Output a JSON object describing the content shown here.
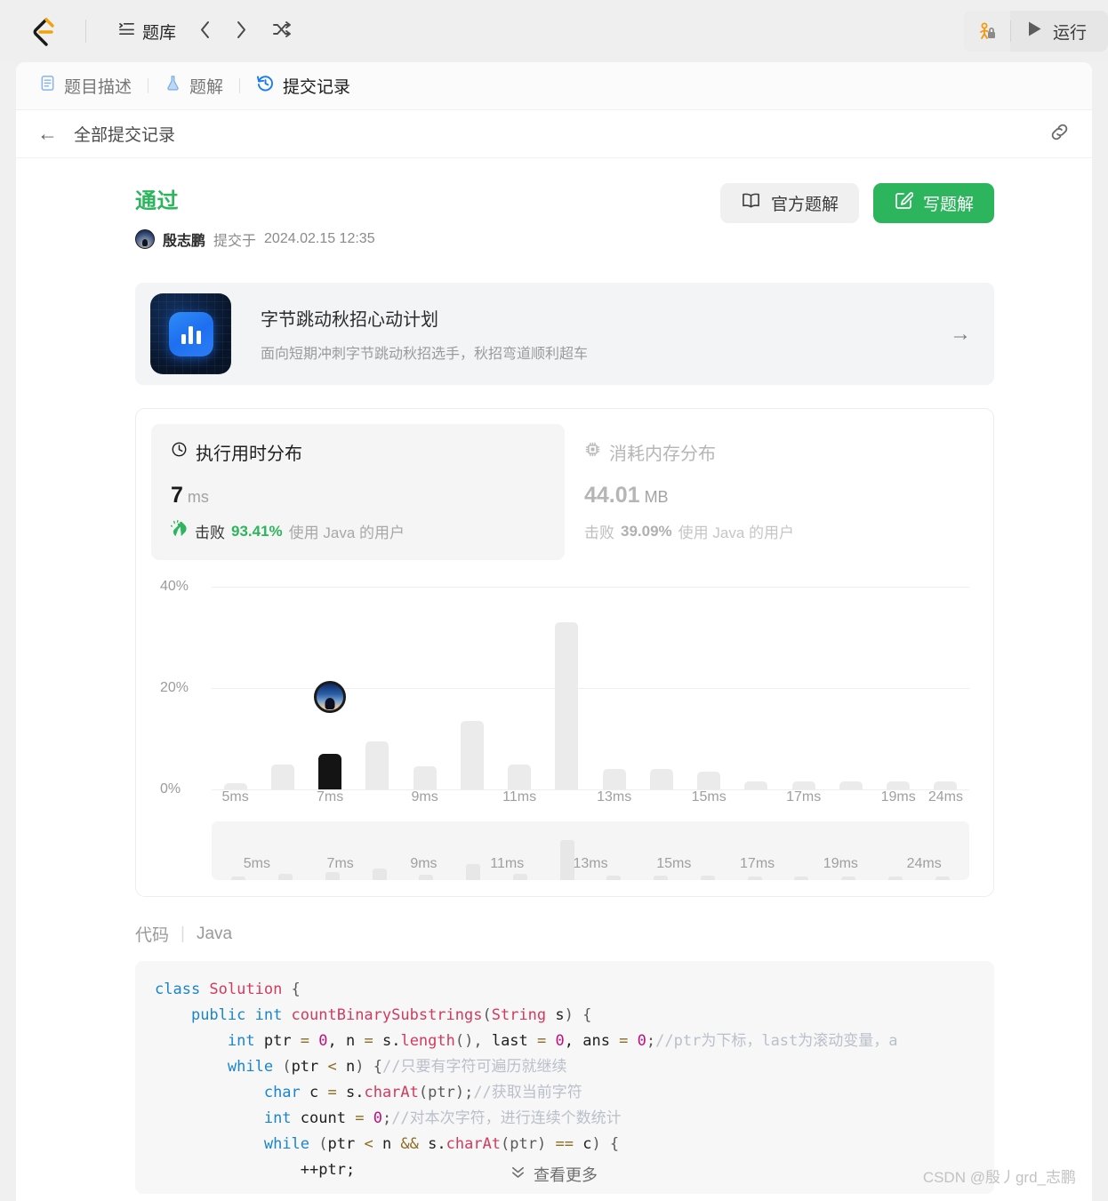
{
  "topbar": {
    "logo_alt": "leetcode-logo",
    "nav": {
      "problems_label": "题库"
    },
    "prev_label": "‹",
    "next_label": "›",
    "shuffle_label": "⤫",
    "run_label": "运行",
    "debug_icon": "debug-lock-icon"
  },
  "tabs": [
    {
      "label": "题目描述",
      "icon": "description-icon",
      "active": false
    },
    {
      "label": "题解",
      "icon": "flask-icon",
      "active": false
    },
    {
      "label": "提交记录",
      "icon": "history-icon",
      "active": true
    }
  ],
  "breadcrumb": {
    "back_label": "←",
    "text": "全部提交记录",
    "link_icon": "link-icon"
  },
  "submission": {
    "verdict": "通过",
    "user": "殷志鹏",
    "submitted_prefix": "提交于",
    "submitted_at": "2024.02.15 12:35",
    "verdict_color": "#2db55d"
  },
  "actions": {
    "official_label": "官方题解",
    "official_icon": "book-icon",
    "write_label": "写题解",
    "write_icon": "pencil-icon",
    "write_color": "#2db55d"
  },
  "promo": {
    "title": "字节跳动秋招心动计划",
    "subtitle": "面向短期冲刺字节跳动秋招选手，秋招弯道顺利超车",
    "arrow": "→",
    "icon": "bar-chart-app-icon"
  },
  "stats": {
    "runtime": {
      "title": "执行用时分布",
      "icon": "clock-icon",
      "value": "7",
      "unit": "ms",
      "beat_label": "击败",
      "beat_pct": "93.41%",
      "beat_tail": "使用 Java 的用户",
      "beat_icon": "clap-icon",
      "active": true
    },
    "memory": {
      "title": "消耗内存分布",
      "icon": "chip-icon",
      "value": "44.01",
      "unit": "MB",
      "beat_label": "击败",
      "beat_pct": "39.09%",
      "beat_tail": "使用 Java 的用户",
      "active": false
    }
  },
  "chart_data": {
    "type": "bar",
    "title": "执行用时分布",
    "xlabel": "",
    "ylabel": "",
    "ylim": [
      0,
      40
    ],
    "yticks": [
      "0%",
      "20%",
      "40%"
    ],
    "grid": true,
    "legend": null,
    "highlight_category": "7ms",
    "highlight_color": "#141414",
    "bar_color": "#ebebeb",
    "categories": [
      "5ms",
      "6ms",
      "7ms",
      "8ms",
      "9ms",
      "10ms",
      "11ms",
      "12ms",
      "13ms",
      "14ms",
      "15ms",
      "16ms",
      "17ms",
      "18ms",
      "19ms",
      "24ms"
    ],
    "tick_labels": [
      "5ms",
      "",
      "7ms",
      "",
      "9ms",
      "",
      "11ms",
      "",
      "13ms",
      "",
      "15ms",
      "",
      "17ms",
      "",
      "19ms",
      "24ms"
    ],
    "values": [
      1.2,
      5.0,
      7.0,
      9.5,
      4.5,
      13.5,
      5.0,
      33.0,
      4.0,
      4.0,
      3.5,
      1.5,
      1.5,
      1.5,
      1.5,
      1.5
    ],
    "avatar_marker": {
      "category": "7ms",
      "y": 14.0
    }
  },
  "brush": {
    "labels": [
      "5ms",
      "7ms",
      "9ms",
      "11ms",
      "13ms",
      "15ms",
      "17ms",
      "19ms",
      "24ms"
    ],
    "values": [
      1.2,
      5.0,
      7.0,
      9.5,
      4.5,
      13.5,
      5.0,
      33.0,
      4.0,
      4.0,
      3.5,
      1.5,
      1.5,
      1.5,
      1.5,
      1.5
    ]
  },
  "code": {
    "header_label": "代码",
    "header_sep": "|",
    "language": "Java",
    "lines": [
      [
        {
          "t": "class ",
          "c": "k"
        },
        {
          "t": "Solution",
          "c": "t"
        },
        {
          "t": " {",
          "c": "p"
        }
      ],
      [
        {
          "t": "    ",
          "c": "v"
        },
        {
          "t": "public int ",
          "c": "k"
        },
        {
          "t": "countBinarySubstrings",
          "c": "t"
        },
        {
          "t": "(",
          "c": "p"
        },
        {
          "t": "String",
          "c": "t"
        },
        {
          "t": " s",
          "c": "v"
        },
        {
          "t": ") {",
          "c": "p"
        }
      ],
      [
        {
          "t": "        ",
          "c": "v"
        },
        {
          "t": "int ",
          "c": "k"
        },
        {
          "t": "ptr ",
          "c": "v"
        },
        {
          "t": "= ",
          "c": "o"
        },
        {
          "t": "0",
          "c": "n"
        },
        {
          "t": ", n ",
          "c": "v"
        },
        {
          "t": "= ",
          "c": "o"
        },
        {
          "t": "s.",
          "c": "v"
        },
        {
          "t": "length",
          "c": "t"
        },
        {
          "t": "(), ",
          "c": "p"
        },
        {
          "t": "last ",
          "c": "v"
        },
        {
          "t": "= ",
          "c": "o"
        },
        {
          "t": "0",
          "c": "n"
        },
        {
          "t": ", ans ",
          "c": "v"
        },
        {
          "t": "= ",
          "c": "o"
        },
        {
          "t": "0",
          "c": "n"
        },
        {
          "t": ";",
          "c": "p"
        },
        {
          "t": "//ptr为下标，last为滚动变量，a",
          "c": "cm"
        }
      ],
      [
        {
          "t": "        ",
          "c": "v"
        },
        {
          "t": "while ",
          "c": "k"
        },
        {
          "t": "(",
          "c": "p"
        },
        {
          "t": "ptr ",
          "c": "v"
        },
        {
          "t": "< ",
          "c": "o"
        },
        {
          "t": "n",
          "c": "v"
        },
        {
          "t": ") {",
          "c": "p"
        },
        {
          "t": "//只要有字符可遍历就继续",
          "c": "cm"
        }
      ],
      [
        {
          "t": "            ",
          "c": "v"
        },
        {
          "t": "char ",
          "c": "k"
        },
        {
          "t": "c ",
          "c": "v"
        },
        {
          "t": "= ",
          "c": "o"
        },
        {
          "t": "s.",
          "c": "v"
        },
        {
          "t": "charAt",
          "c": "t"
        },
        {
          "t": "(ptr);",
          "c": "p"
        },
        {
          "t": "//获取当前字符",
          "c": "cm"
        }
      ],
      [
        {
          "t": "            ",
          "c": "v"
        },
        {
          "t": "int ",
          "c": "k"
        },
        {
          "t": "count ",
          "c": "v"
        },
        {
          "t": "= ",
          "c": "o"
        },
        {
          "t": "0",
          "c": "n"
        },
        {
          "t": ";",
          "c": "p"
        },
        {
          "t": "//对本次字符，进行连续个数统计",
          "c": "cm"
        }
      ],
      [
        {
          "t": "            ",
          "c": "v"
        },
        {
          "t": "while ",
          "c": "k"
        },
        {
          "t": "(",
          "c": "p"
        },
        {
          "t": "ptr ",
          "c": "v"
        },
        {
          "t": "< ",
          "c": "o"
        },
        {
          "t": "n ",
          "c": "v"
        },
        {
          "t": "&& ",
          "c": "o"
        },
        {
          "t": "s.",
          "c": "v"
        },
        {
          "t": "charAt",
          "c": "t"
        },
        {
          "t": "(ptr) ",
          "c": "p"
        },
        {
          "t": "== ",
          "c": "o"
        },
        {
          "t": "c",
          "c": "v"
        },
        {
          "t": ") {",
          "c": "p"
        }
      ],
      [
        {
          "t": "                ",
          "c": "v"
        },
        {
          "t": "++ptr;",
          "c": "v"
        }
      ]
    ]
  },
  "footer": {
    "more_label": "查看更多",
    "more_icon": "chevron-double-down-icon",
    "watermark": "CSDN @殷丿grd_志鹏"
  }
}
